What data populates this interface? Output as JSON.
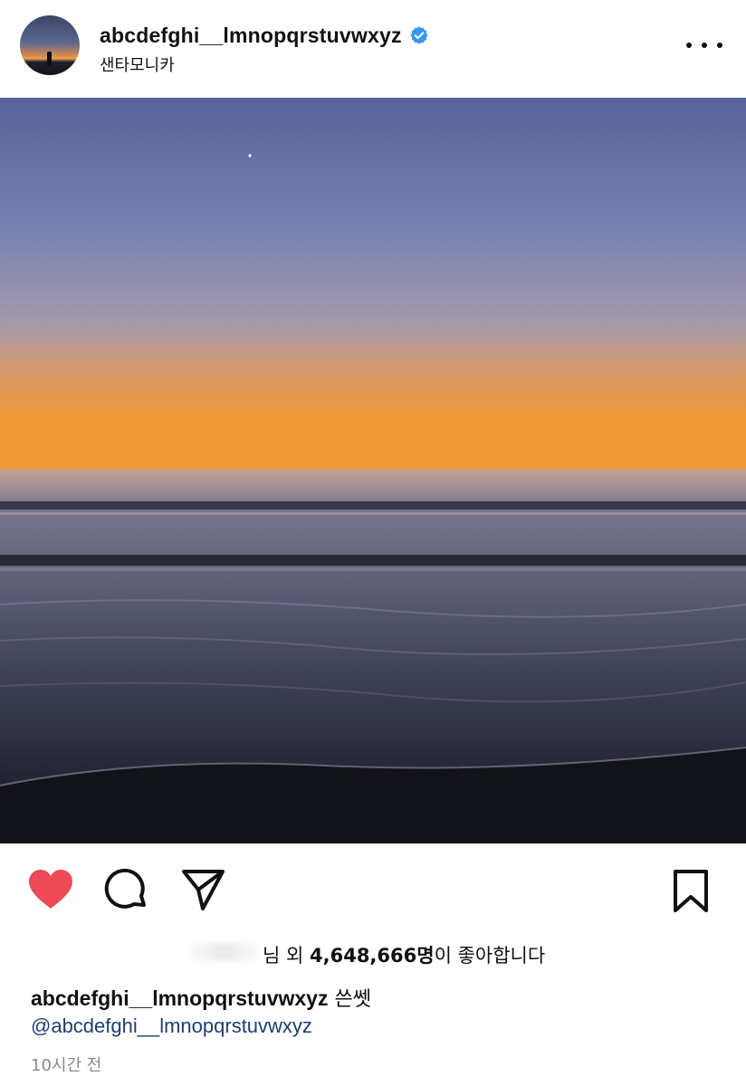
{
  "header": {
    "username": "abcdefghi__lmnopqrstuvwxyz",
    "location": "샌타모니카",
    "verified": true
  },
  "post": {
    "image_description_icon": "sunset-beach-photo"
  },
  "actions": {
    "liked": true,
    "heart_color": "#ed4956"
  },
  "likes": {
    "prefix": "님 외 ",
    "count": "4,648,666명",
    "suffix": "이 좋아합니다"
  },
  "caption": {
    "username": "abcdefghi__lmnopqrstuvwxyz",
    "text": " 쓴쎗",
    "mention": "@abcdefghi__lmnopqrstuvwxyz"
  },
  "timestamp": "10시간 전",
  "colors": {
    "verified_blue": "#3897f0",
    "mention_blue": "#1d3f6e",
    "muted": "#8a8a8a"
  }
}
